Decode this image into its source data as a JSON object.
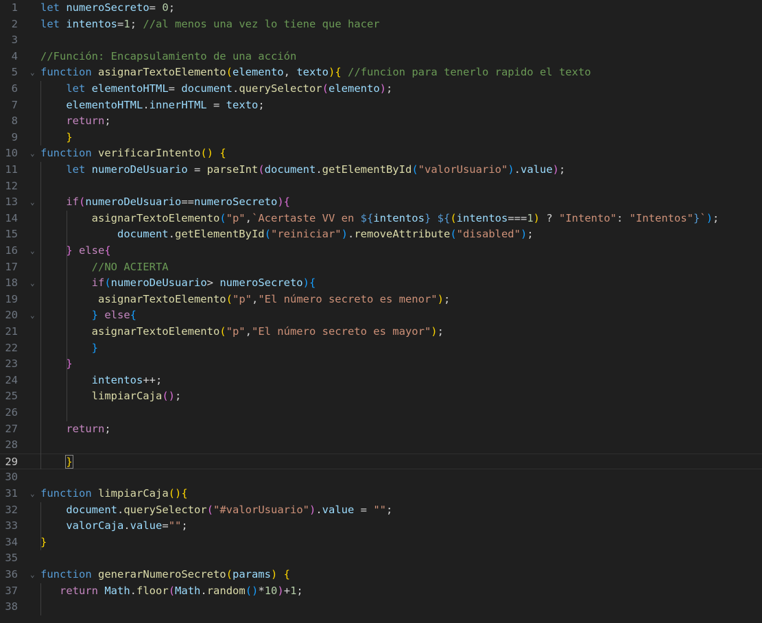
{
  "editor": {
    "language": "javascript",
    "current_line": 29,
    "colors": {
      "background": "#1f1f1f",
      "keyword": "#569cd6",
      "control": "#c586c0",
      "function": "#dcdcaa",
      "variable": "#9cdcfe",
      "string": "#ce9178",
      "number": "#b5cea8",
      "comment": "#6a9955",
      "bracket_level_1": "#ffd700",
      "bracket_level_2": "#da70d6",
      "bracket_level_3": "#179fff"
    },
    "lines": [
      {
        "n": "1",
        "fold": "",
        "tokens": [
          [
            "kw",
            "let"
          ],
          [
            "op",
            " "
          ],
          [
            "var",
            "numeroSecreto"
          ],
          [
            "op",
            "= "
          ],
          [
            "num",
            "0"
          ],
          [
            "op",
            ";"
          ]
        ]
      },
      {
        "n": "2",
        "fold": "",
        "tokens": [
          [
            "kw",
            "let"
          ],
          [
            "op",
            " "
          ],
          [
            "var",
            "intentos"
          ],
          [
            "op",
            "="
          ],
          [
            "num",
            "1"
          ],
          [
            "op",
            "; "
          ],
          [
            "cm",
            "//al menos una vez lo tiene que hacer"
          ]
        ]
      },
      {
        "n": "3",
        "fold": "",
        "tokens": []
      },
      {
        "n": "4",
        "fold": "",
        "tokens": [
          [
            "cm",
            "//Función: Encapsulamiento de una acción"
          ]
        ]
      },
      {
        "n": "5",
        "fold": "⌄",
        "tokens": [
          [
            "kw",
            "function"
          ],
          [
            "op",
            " "
          ],
          [
            "fn",
            "asignarTextoElemento"
          ],
          [
            "b1",
            "("
          ],
          [
            "var",
            "elemento"
          ],
          [
            "op",
            ", "
          ],
          [
            "var",
            "texto"
          ],
          [
            "b1",
            ")"
          ],
          [
            "b1",
            "{"
          ],
          [
            "op",
            " "
          ],
          [
            "cm",
            "//funcion para tenerlo rapido el texto"
          ]
        ]
      },
      {
        "n": "6",
        "fold": "",
        "tokens": [
          [
            "op",
            "    "
          ],
          [
            "kw",
            "let"
          ],
          [
            "op",
            " "
          ],
          [
            "var",
            "elementoHTML"
          ],
          [
            "op",
            "= "
          ],
          [
            "var",
            "document"
          ],
          [
            "op",
            "."
          ],
          [
            "fn",
            "querySelector"
          ],
          [
            "b2",
            "("
          ],
          [
            "var",
            "elemento"
          ],
          [
            "b2",
            ")"
          ],
          [
            "op",
            ";"
          ]
        ]
      },
      {
        "n": "7",
        "fold": "",
        "tokens": [
          [
            "op",
            "    "
          ],
          [
            "var",
            "elementoHTML"
          ],
          [
            "op",
            "."
          ],
          [
            "var",
            "innerHTML"
          ],
          [
            "op",
            " = "
          ],
          [
            "var",
            "texto"
          ],
          [
            "op",
            ";"
          ]
        ]
      },
      {
        "n": "8",
        "fold": "",
        "tokens": [
          [
            "op",
            "    "
          ],
          [
            "ctl",
            "return"
          ],
          [
            "op",
            ";"
          ]
        ]
      },
      {
        "n": "9",
        "fold": "",
        "tokens": [
          [
            "op",
            "    "
          ],
          [
            "b1",
            "}"
          ]
        ]
      },
      {
        "n": "10",
        "fold": "⌄",
        "tokens": [
          [
            "kw",
            "function"
          ],
          [
            "op",
            " "
          ],
          [
            "fn",
            "verificarIntento"
          ],
          [
            "b1",
            "()"
          ],
          [
            "op",
            " "
          ],
          [
            "b1",
            "{"
          ]
        ]
      },
      {
        "n": "11",
        "fold": "",
        "tokens": [
          [
            "op",
            "    "
          ],
          [
            "kw",
            "let"
          ],
          [
            "op",
            " "
          ],
          [
            "var",
            "numeroDeUsuario"
          ],
          [
            "op",
            " = "
          ],
          [
            "fn",
            "parseInt"
          ],
          [
            "b2",
            "("
          ],
          [
            "var",
            "document"
          ],
          [
            "op",
            "."
          ],
          [
            "fn",
            "getElementById"
          ],
          [
            "b3",
            "("
          ],
          [
            "str",
            "\"valorUsuario\""
          ],
          [
            "b3",
            ")"
          ],
          [
            "op",
            "."
          ],
          [
            "var",
            "value"
          ],
          [
            "b2",
            ")"
          ],
          [
            "op",
            ";"
          ]
        ]
      },
      {
        "n": "12",
        "fold": "",
        "tokens": []
      },
      {
        "n": "13",
        "fold": "⌄",
        "tokens": [
          [
            "op",
            "    "
          ],
          [
            "ctl",
            "if"
          ],
          [
            "b2",
            "("
          ],
          [
            "var",
            "numeroDeUsuario"
          ],
          [
            "op",
            "=="
          ],
          [
            "var",
            "numeroSecreto"
          ],
          [
            "b2",
            ")"
          ],
          [
            "b2",
            "{"
          ]
        ]
      },
      {
        "n": "14",
        "fold": "",
        "tokens": [
          [
            "op",
            "        "
          ],
          [
            "fn",
            "asignarTextoElemento"
          ],
          [
            "b3",
            "("
          ],
          [
            "str",
            "\"p\""
          ],
          [
            "op",
            ","
          ],
          [
            "str",
            "`Acertaste VV en "
          ],
          [
            "kw",
            "${"
          ],
          [
            "var",
            "intentos"
          ],
          [
            "kw",
            "}"
          ],
          [
            "str",
            " "
          ],
          [
            "kw",
            "${"
          ],
          [
            "b1",
            "("
          ],
          [
            "var",
            "intentos"
          ],
          [
            "op",
            "==="
          ],
          [
            "num",
            "1"
          ],
          [
            "b1",
            ")"
          ],
          [
            "op",
            " ? "
          ],
          [
            "str",
            "\"Intento\""
          ],
          [
            "op",
            ": "
          ],
          [
            "str",
            "\"Intentos\""
          ],
          [
            "kw",
            "}"
          ],
          [
            "str",
            "`"
          ],
          [
            "b3",
            ")"
          ],
          [
            "op",
            ";"
          ]
        ]
      },
      {
        "n": "15",
        "fold": "",
        "tokens": [
          [
            "op",
            "            "
          ],
          [
            "var",
            "document"
          ],
          [
            "op",
            "."
          ],
          [
            "fn",
            "getElementById"
          ],
          [
            "b3",
            "("
          ],
          [
            "str",
            "\"reiniciar\""
          ],
          [
            "b3",
            ")"
          ],
          [
            "op",
            "."
          ],
          [
            "fn",
            "removeAttribute"
          ],
          [
            "b3",
            "("
          ],
          [
            "str",
            "\"disabled\""
          ],
          [
            "b3",
            ")"
          ],
          [
            "op",
            ";"
          ]
        ]
      },
      {
        "n": "16",
        "fold": "⌄",
        "tokens": [
          [
            "op",
            "    "
          ],
          [
            "b2",
            "}"
          ],
          [
            "op",
            " "
          ],
          [
            "ctl",
            "else"
          ],
          [
            "b2",
            "{"
          ]
        ]
      },
      {
        "n": "17",
        "fold": "",
        "tokens": [
          [
            "op",
            "        "
          ],
          [
            "cm",
            "//NO ACIERTA"
          ]
        ]
      },
      {
        "n": "18",
        "fold": "⌄",
        "tokens": [
          [
            "op",
            "        "
          ],
          [
            "ctl",
            "if"
          ],
          [
            "b3",
            "("
          ],
          [
            "var",
            "numeroDeUsuario"
          ],
          [
            "op",
            "> "
          ],
          [
            "var",
            "numeroSecreto"
          ],
          [
            "b3",
            ")"
          ],
          [
            "b3",
            "{"
          ]
        ]
      },
      {
        "n": "19",
        "fold": "",
        "tokens": [
          [
            "op",
            "         "
          ],
          [
            "fn",
            "asignarTextoElemento"
          ],
          [
            "b1",
            "("
          ],
          [
            "str",
            "\"p\""
          ],
          [
            "op",
            ","
          ],
          [
            "str",
            "\"El número secreto es menor\""
          ],
          [
            "b1",
            ")"
          ],
          [
            "op",
            ";"
          ]
        ]
      },
      {
        "n": "20",
        "fold": "⌄",
        "tokens": [
          [
            "op",
            "        "
          ],
          [
            "b3",
            "}"
          ],
          [
            "op",
            " "
          ],
          [
            "ctl",
            "else"
          ],
          [
            "b3",
            "{"
          ]
        ]
      },
      {
        "n": "21",
        "fold": "",
        "tokens": [
          [
            "op",
            "        "
          ],
          [
            "fn",
            "asignarTextoElemento"
          ],
          [
            "b1",
            "("
          ],
          [
            "str",
            "\"p\""
          ],
          [
            "op",
            ","
          ],
          [
            "str",
            "\"El número secreto es mayor\""
          ],
          [
            "b1",
            ")"
          ],
          [
            "op",
            ";"
          ]
        ]
      },
      {
        "n": "22",
        "fold": "",
        "tokens": [
          [
            "op",
            "        "
          ],
          [
            "b3",
            "}"
          ]
        ]
      },
      {
        "n": "23",
        "fold": "",
        "tokens": [
          [
            "op",
            "    "
          ],
          [
            "b2",
            "}"
          ]
        ]
      },
      {
        "n": "24",
        "fold": "",
        "tokens": [
          [
            "op",
            "        "
          ],
          [
            "var",
            "intentos"
          ],
          [
            "op",
            "++;"
          ]
        ]
      },
      {
        "n": "25",
        "fold": "",
        "tokens": [
          [
            "op",
            "        "
          ],
          [
            "fn",
            "limpiarCaja"
          ],
          [
            "b2",
            "()"
          ],
          [
            "op",
            ";"
          ]
        ]
      },
      {
        "n": "26",
        "fold": "",
        "tokens": []
      },
      {
        "n": "27",
        "fold": "",
        "tokens": [
          [
            "op",
            "    "
          ],
          [
            "ctl",
            "return"
          ],
          [
            "op",
            ";"
          ]
        ]
      },
      {
        "n": "28",
        "fold": "",
        "tokens": []
      },
      {
        "n": "29",
        "fold": "",
        "tokens": [
          [
            "op",
            "    "
          ],
          [
            "b1",
            "}"
          ]
        ]
      },
      {
        "n": "30",
        "fold": "",
        "tokens": []
      },
      {
        "n": "31",
        "fold": "⌄",
        "tokens": [
          [
            "kw",
            "function"
          ],
          [
            "op",
            " "
          ],
          [
            "fn",
            "limpiarCaja"
          ],
          [
            "b1",
            "()"
          ],
          [
            "b1",
            "{"
          ]
        ]
      },
      {
        "n": "32",
        "fold": "",
        "tokens": [
          [
            "op",
            "    "
          ],
          [
            "var",
            "document"
          ],
          [
            "op",
            "."
          ],
          [
            "fn",
            "querySelector"
          ],
          [
            "b2",
            "("
          ],
          [
            "str",
            "\"#valorUsuario\""
          ],
          [
            "b2",
            ")"
          ],
          [
            "op",
            "."
          ],
          [
            "var",
            "value"
          ],
          [
            "op",
            " = "
          ],
          [
            "str",
            "\"\""
          ],
          [
            "op",
            ";"
          ]
        ]
      },
      {
        "n": "33",
        "fold": "",
        "tokens": [
          [
            "op",
            "    "
          ],
          [
            "var",
            "valorCaja"
          ],
          [
            "op",
            "."
          ],
          [
            "var",
            "value"
          ],
          [
            "op",
            "="
          ],
          [
            "str",
            "\"\""
          ],
          [
            "op",
            ";"
          ]
        ]
      },
      {
        "n": "34",
        "fold": "",
        "tokens": [
          [
            "b1",
            "}"
          ]
        ]
      },
      {
        "n": "35",
        "fold": "",
        "tokens": []
      },
      {
        "n": "36",
        "fold": "⌄",
        "tokens": [
          [
            "kw",
            "function"
          ],
          [
            "op",
            " "
          ],
          [
            "fn",
            "generarNumeroSecreto"
          ],
          [
            "b1",
            "("
          ],
          [
            "var",
            "params"
          ],
          [
            "b1",
            ")"
          ],
          [
            "op",
            " "
          ],
          [
            "b1",
            "{"
          ]
        ]
      },
      {
        "n": "37",
        "fold": "",
        "tokens": [
          [
            "op",
            "   "
          ],
          [
            "ctl",
            "return"
          ],
          [
            "op",
            " "
          ],
          [
            "var",
            "Math"
          ],
          [
            "op",
            "."
          ],
          [
            "fn",
            "floor"
          ],
          [
            "b2",
            "("
          ],
          [
            "var",
            "Math"
          ],
          [
            "op",
            "."
          ],
          [
            "fn",
            "random"
          ],
          [
            "b3",
            "()"
          ],
          [
            "op",
            "*"
          ],
          [
            "num",
            "10"
          ],
          [
            "b2",
            ")"
          ],
          [
            "op",
            "+"
          ],
          [
            "num",
            "1"
          ],
          [
            "op",
            ";"
          ]
        ]
      },
      {
        "n": "38",
        "fold": "",
        "tokens": []
      }
    ]
  }
}
